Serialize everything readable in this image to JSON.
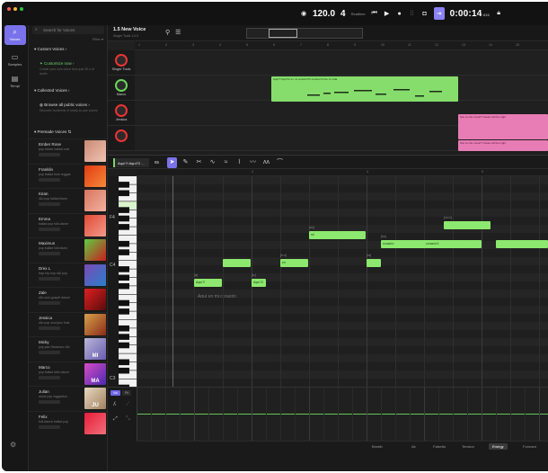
{
  "toolbar": {
    "tempo": "120.0",
    "time_signature": "4",
    "realtime_label": "RealtIme",
    "timer": "0:00:14",
    "timer_suffix": ".836"
  },
  "rail": {
    "items": [
      {
        "label": "Voices",
        "icon": "search-icon"
      },
      {
        "label": "Samples",
        "icon": "waveform-icon"
      },
      {
        "label": "Templ",
        "icon": "document-icon"
      }
    ]
  },
  "voices_panel": {
    "search_placeholder": "Search for Voices",
    "filter_label": "Filter ▾",
    "custom_header": "▾ Custom Voices ›",
    "custom_item": "Customize now ›",
    "custom_desc": "Create your own voice from just 30 s of audio",
    "collected_header": "▾ Collected Voices ›",
    "collected_item": "Browse all public voices ›",
    "collected_desc": "Discover hundreds of ready-to-use voices",
    "premade_header": "▾ Premade Voices ⇅",
    "list": [
      {
        "name": "Ember Rose",
        "desc": "pop dance ballad rock",
        "label": ""
      },
      {
        "name": "Franklin",
        "desc": "pop ballad funk reggae",
        "label": ""
      },
      {
        "name": "Kiran",
        "desc": "r&b pop ballad blues",
        "label": ""
      },
      {
        "name": "Emma",
        "desc": "ballad pop folk dance",
        "label": ""
      },
      {
        "name": "Maximus",
        "desc": "pop ballad folk blues",
        "label": ""
      },
      {
        "name": "Drex L",
        "desc": "trap hip-hop r&b pop",
        "label": ""
      },
      {
        "name": "Zale",
        "desc": "r&b soul gospel dance",
        "label": ""
      },
      {
        "name": "Jessica",
        "desc": "r&b pop soul jazz funk",
        "label": ""
      },
      {
        "name": "Micky",
        "desc": "pop jazz flamenco r&b",
        "label": "MI"
      },
      {
        "name": "Marco",
        "desc": "pop ballad latin dance",
        "label": "MA"
      },
      {
        "name": "Julian",
        "desc": "world pop reggaeton",
        "label": "JU"
      },
      {
        "name": "Felix",
        "desc": "folk dance ballad pop",
        "label": ""
      }
    ]
  },
  "project": {
    "title": "1.5 New Voice",
    "subtitle": "Singer Tools 1.0.0"
  },
  "tracks": [
    {
      "name": "Singer Tools"
    },
    {
      "name": "Marco"
    },
    {
      "name": "Jessica"
    }
  ],
  "clips": {
    "marco": "Aquí?! Aquí?2 en mi corazón?3 corazón?4 de mi vida",
    "jessica_1": "Sun so the music?! dream all the night",
    "jessica_2": "Sun so the music?! dream all the night"
  },
  "piano_roll": {
    "track_chip": "Aquí?! Aquí?2 ...",
    "track_number": "85",
    "key_labels": [
      "F4",
      "C4",
      "C3"
    ],
    "lyric_line": "Aquí en mi corazón",
    "notes": [
      {
        "text": "Aquí?!",
        "label": "[a]"
      },
      {
        "text": "Aquí?2",
        "label": "[a:]"
      },
      {
        "text": "",
        "label": ""
      },
      {
        "text": "en",
        "label": "[e:n]"
      },
      {
        "text": "mi",
        "label": "[mi]"
      },
      {
        "text": "corazón",
        "label": "[ko]"
      },
      {
        "text": "",
        "label": "[ra]"
      },
      {
        "text": "corazón2",
        "label": ""
      },
      {
        "text": "",
        "label": "[zo:n]"
      },
      {
        "text": "",
        "label": ""
      }
    ]
  },
  "automation": {
    "tab_active": "Vol",
    "tab_other": "Pit",
    "params": [
      "Breath",
      "Air",
      "Falsetto",
      "Tension",
      "Energy",
      "Formant"
    ],
    "active_param": "Energy"
  },
  "ruler": [
    "1",
    "2",
    "3",
    "4",
    "5",
    "6",
    "7",
    "8",
    "9",
    "10",
    "11",
    "12",
    "13",
    "14",
    "15"
  ]
}
